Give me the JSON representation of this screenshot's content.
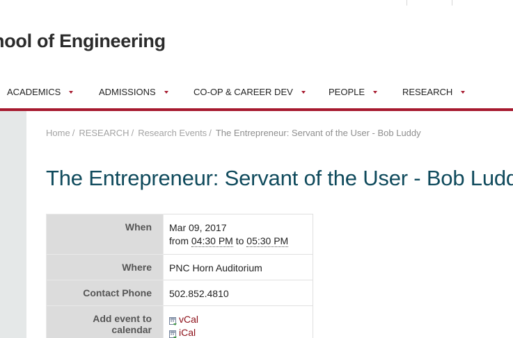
{
  "header": {
    "site_title": "hool of Engineering"
  },
  "nav": {
    "items": [
      {
        "label": "ACADEMICS"
      },
      {
        "label": "ADMISSIONS"
      },
      {
        "label": "CO-OP & CAREER DEV"
      },
      {
        "label": "PEOPLE"
      },
      {
        "label": "RESEARCH"
      }
    ]
  },
  "breadcrumb": {
    "items": [
      "Home",
      "RESEARCH",
      "Research Events"
    ],
    "current": "The Entrepreneur: Servant of the User - Bob Luddy"
  },
  "event": {
    "title": "The Entrepreneur: Servant of the User - Bob Luddy",
    "when_label": "When",
    "date": "Mar 09, 2017",
    "from_word": "from",
    "start_time": "04:30 PM",
    "to_word": "to",
    "end_time": "05:30 PM",
    "where_label": "Where",
    "location": "PNC Horn Auditorium",
    "phone_label": "Contact Phone",
    "phone": "502.852.4810",
    "calendar_label": "Add event to calendar",
    "calendar_links": [
      {
        "label": "vCal",
        "icon": "calendar-file-icon"
      },
      {
        "label": "iCal",
        "icon": "calendar-file-icon"
      }
    ]
  },
  "colors": {
    "accent": "#a6192e",
    "title": "#0f4a5c",
    "link": "#8b0d16"
  }
}
